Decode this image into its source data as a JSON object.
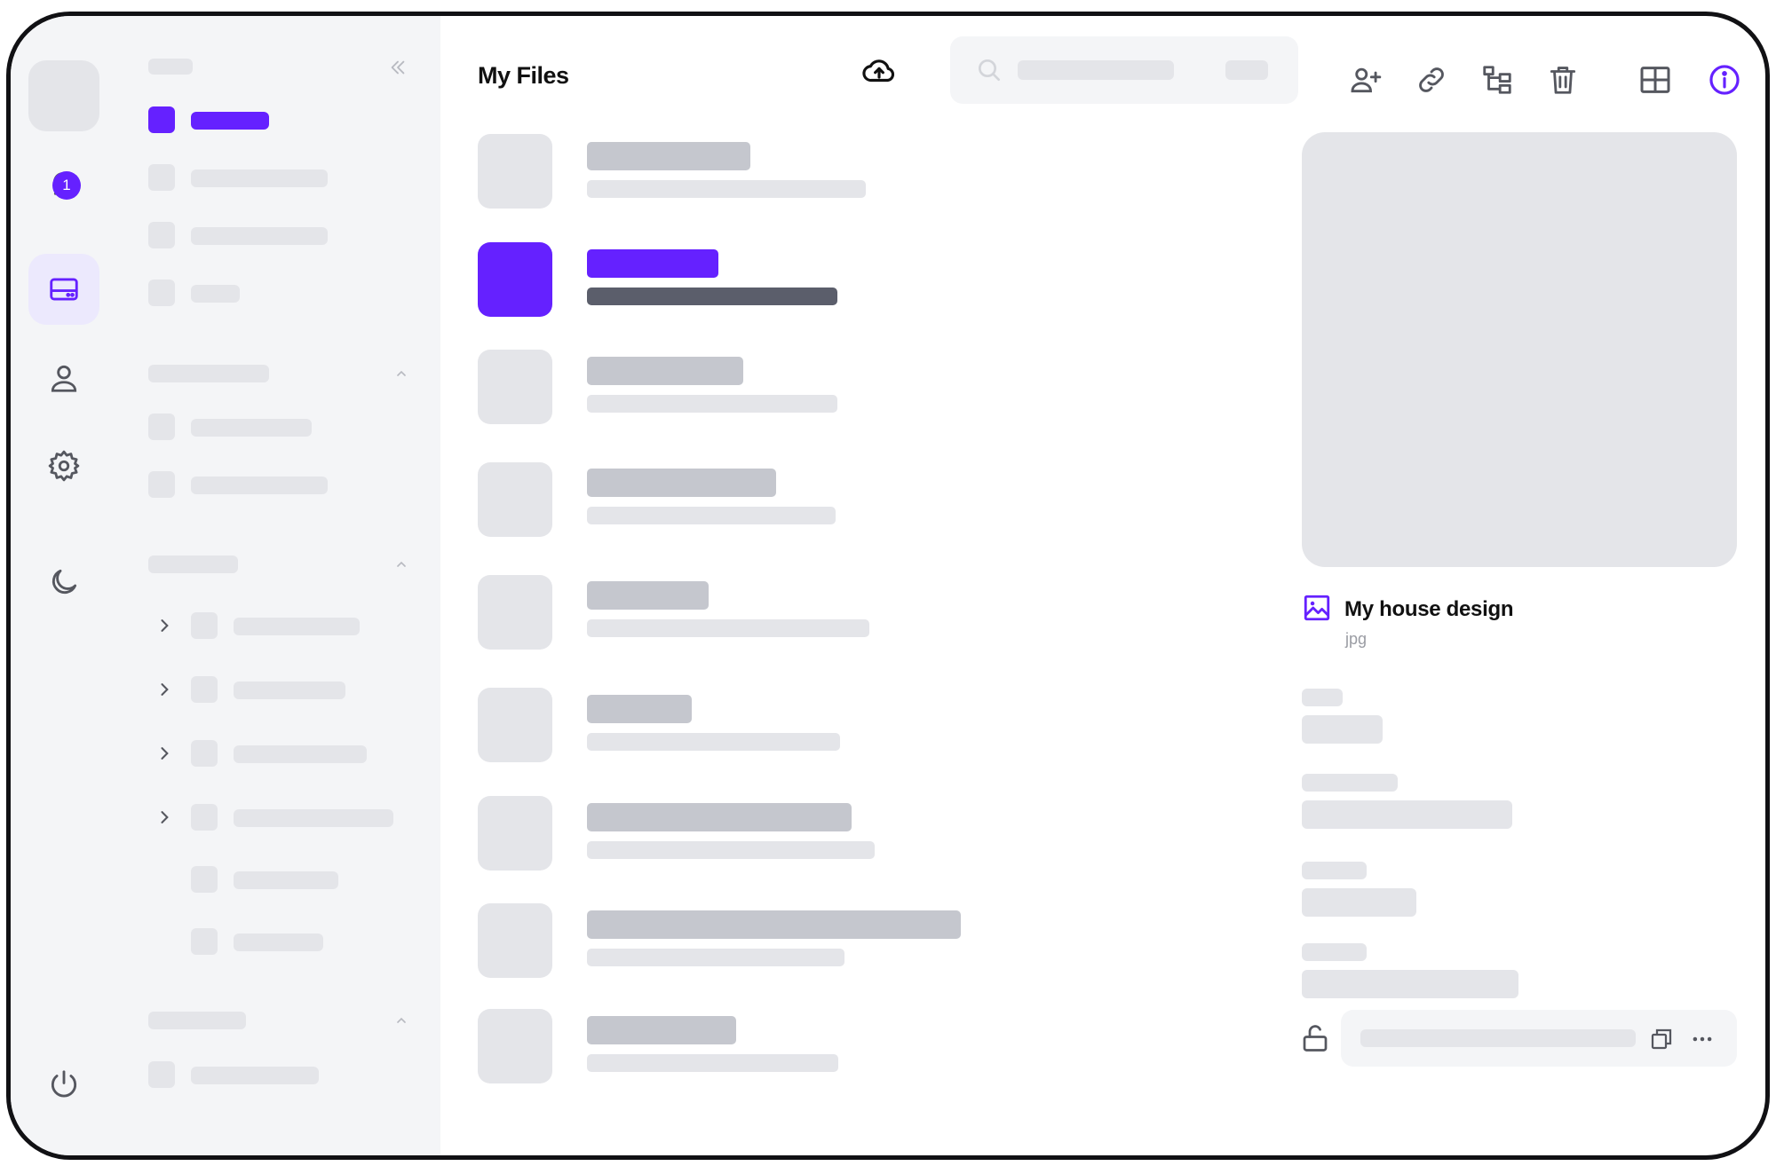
{
  "header": {
    "title": "My Files"
  },
  "rail": {
    "notification_count": "1",
    "icons": [
      "bell-icon",
      "drive-icon",
      "user-icon",
      "gear-icon",
      "moon-icon",
      "power-icon"
    ]
  },
  "toolbar": {
    "icons": [
      "upload-cloud-icon",
      "search-icon",
      "share-user-icon",
      "link-icon",
      "move-icon",
      "trash-icon",
      "grid-view-icon",
      "info-icon"
    ]
  },
  "details": {
    "file_name": "My house design",
    "file_type": "jpg"
  },
  "colors": {
    "accent": "#6521ff",
    "skeleton": "#e4e5e9",
    "skeleton_dark": "#c5c7ce",
    "panel_bg": "#f4f5f7"
  }
}
